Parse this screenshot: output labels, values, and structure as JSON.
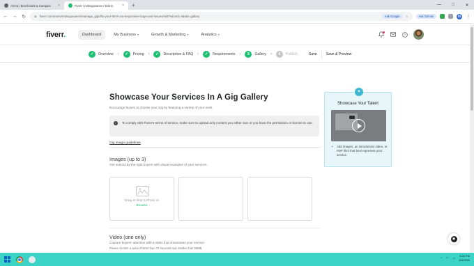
{
  "browser": {
    "tabs": [
      {
        "label": "Arena | Benchmark & Compare",
        "active": false,
        "favicon_color": "#5f6368"
      },
      {
        "label": "Fiverr / mdvsgovanev / Edit G",
        "active": true,
        "favicon_color": "#1dbf73"
      }
    ],
    "new_tab": "+",
    "url": "fiverr.com/users/mdvsgovanev/manage_gigs/fix-your-html-css-responsive-bugs-and-issues/edit?wizard=4&tab=gallery",
    "ask_google": "Ask Google",
    "ask_gemini": "Ask Gemini",
    "profile_initial": "M"
  },
  "header": {
    "logo": "fiverr",
    "logo_dot": ".",
    "nav": [
      {
        "label": "Dashboard",
        "active": true,
        "dropdown": false
      },
      {
        "label": "My Business",
        "active": false,
        "dropdown": true
      },
      {
        "label": "Growth & Marketing",
        "active": false,
        "dropdown": true
      },
      {
        "label": "Analytics",
        "active": false,
        "dropdown": true
      }
    ]
  },
  "steps": [
    {
      "label": "Overview",
      "state": "done",
      "mark": "✓"
    },
    {
      "label": "Pricing",
      "state": "done",
      "mark": "✓"
    },
    {
      "label": "Description & FAQ",
      "state": "done",
      "mark": "✓"
    },
    {
      "label": "Requirements",
      "state": "done",
      "mark": "✓"
    },
    {
      "label": "Gallery",
      "state": "current",
      "mark": "5"
    },
    {
      "label": "Publish",
      "state": "todo",
      "mark": "6"
    }
  ],
  "actions": {
    "save": "Save",
    "save_preview": "Save & Preview"
  },
  "main": {
    "title": "Showcase Your Services In A Gig Gallery",
    "subtitle": "Encourage buyers to choose your Gig by featuring a variety of your work.",
    "notice": "To comply with Fiverr's terms of service, make sure to upload only content you either own or you have the permission or license to use.",
    "guidelines_link": "Gig image guidelines",
    "images_title": "Images (up to 3)",
    "images_sub": "Get noticed by the right buyers with visual examples of your services.",
    "dropzone_text": "Drag & drop a Photo or",
    "dropzone_browse": "Browse",
    "video_title": "Video (one only)",
    "video_sub": "Capture buyers' attention with a video that showcases your service.",
    "video_sub2": "Please choose a video shorter than 75 seconds and smaller than 50MB"
  },
  "showcase_card": {
    "title": "Showcase Your Talent",
    "text": "Add images, an introduction video, or PDF files that best represent your service."
  },
  "taskbar": {
    "time": "5:28 PM",
    "date": "8/5/2026"
  }
}
